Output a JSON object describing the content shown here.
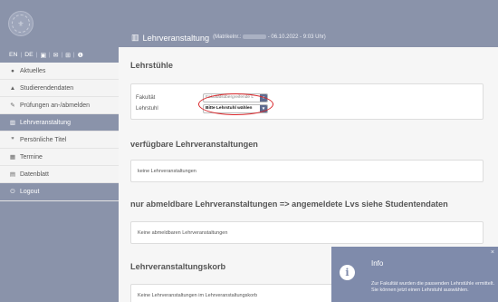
{
  "sidebar": {
    "lang": {
      "en": "EN",
      "de": "DE",
      "sep": "|"
    },
    "items": [
      {
        "label": "Aktuelles",
        "icon": "chat-icon",
        "glyph": "●"
      },
      {
        "label": "Studierendendaten",
        "icon": "graduation-cap-icon",
        "glyph": "▲"
      },
      {
        "label": "Prüfungen an-/abmelden",
        "icon": "edit-icon",
        "glyph": "✎"
      },
      {
        "label": "Lehrveranstaltung",
        "icon": "institution-icon",
        "glyph": "▥"
      },
      {
        "label": "Persönliche Titel",
        "icon": "quote-icon",
        "glyph": "❞"
      },
      {
        "label": "Termine",
        "icon": "calendar-icon",
        "glyph": "▦"
      },
      {
        "label": "Datenblatt",
        "icon": "calendar-check-icon",
        "glyph": "▤"
      },
      {
        "label": "Logout",
        "icon": "power-icon",
        "glyph": "⏻"
      }
    ]
  },
  "header": {
    "title": "Lehrveranstaltung",
    "meta_prefix": "(Matrikelnr.:",
    "meta_suffix": "- 06.10.2022 - 9:03 Uhr)"
  },
  "main": {
    "lehrstuehle": {
      "heading": "Lehrstühle",
      "fakultaet_label": "Fakultät",
      "fakultaet_value": "Fakultätsübergreifende L",
      "lehrstuhl_label": "Lehrstuhl",
      "lehrstuhl_value": "Bitte Lehrstuhl wählen"
    },
    "verfuegbar": {
      "heading": "verfügbare Lehrveranstaltungen",
      "empty": "keine Lehrveranstaltungen"
    },
    "abmeldbar": {
      "heading": "nur abmeldbare Lehrveranstaltungen => angemeldete Lvs siehe Studentendaten",
      "empty": "Keine abmeldbaren Lehrveranstaltungen"
    },
    "korb": {
      "heading": "Lehrveranstaltungskorb",
      "empty": "Keine Lehrveranstaltungen im Lehrveranstaltungskorb"
    }
  },
  "toast": {
    "title": "Info",
    "close": "×",
    "message": "Zur Fakultät wurden die passenden Lehrstühle ermittelt. Sie können jetzt einen Lehrstuhl auswählen."
  },
  "colors": {
    "accent": "#8a93aa",
    "toast": "#7f8bab",
    "highlight": "#d9262a"
  }
}
